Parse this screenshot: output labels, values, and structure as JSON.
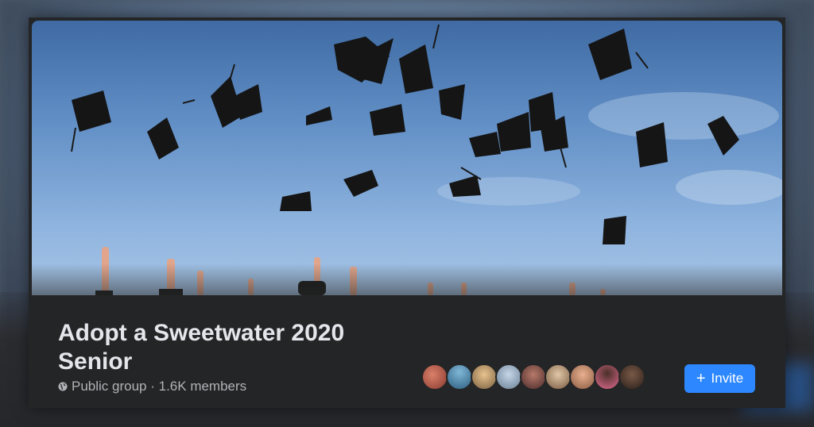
{
  "group": {
    "title": "Adopt a Sweetwater 2020 Senior",
    "privacy": "Public group",
    "separator": " · ",
    "members": "1.6K members",
    "privacy_icon": "globe-icon"
  },
  "invite": {
    "label": "Invite",
    "icon": "+",
    "icon_name": "plus-icon",
    "color": "#2d88ff"
  },
  "cover": {
    "description_icon": "graduation-caps-cover-photo",
    "sky_color": "#5f8dc4"
  },
  "member_avatars": [
    {
      "name": "member-avatar-1",
      "color": "#b85a4a"
    },
    {
      "name": "member-avatar-2",
      "color": "#3d7fa8"
    },
    {
      "name": "member-avatar-3",
      "color": "#c9a46a"
    },
    {
      "name": "member-avatar-4",
      "color": "#8fa8c0"
    },
    {
      "name": "member-avatar-5",
      "color": "#7a4a4a"
    },
    {
      "name": "member-avatar-6",
      "color": "#b89a7a"
    },
    {
      "name": "member-avatar-7",
      "color": "#c48f6e"
    },
    {
      "name": "member-avatar-8",
      "color": "#e07a9a"
    },
    {
      "name": "member-avatar-9",
      "color": "#4a3a32"
    }
  ]
}
